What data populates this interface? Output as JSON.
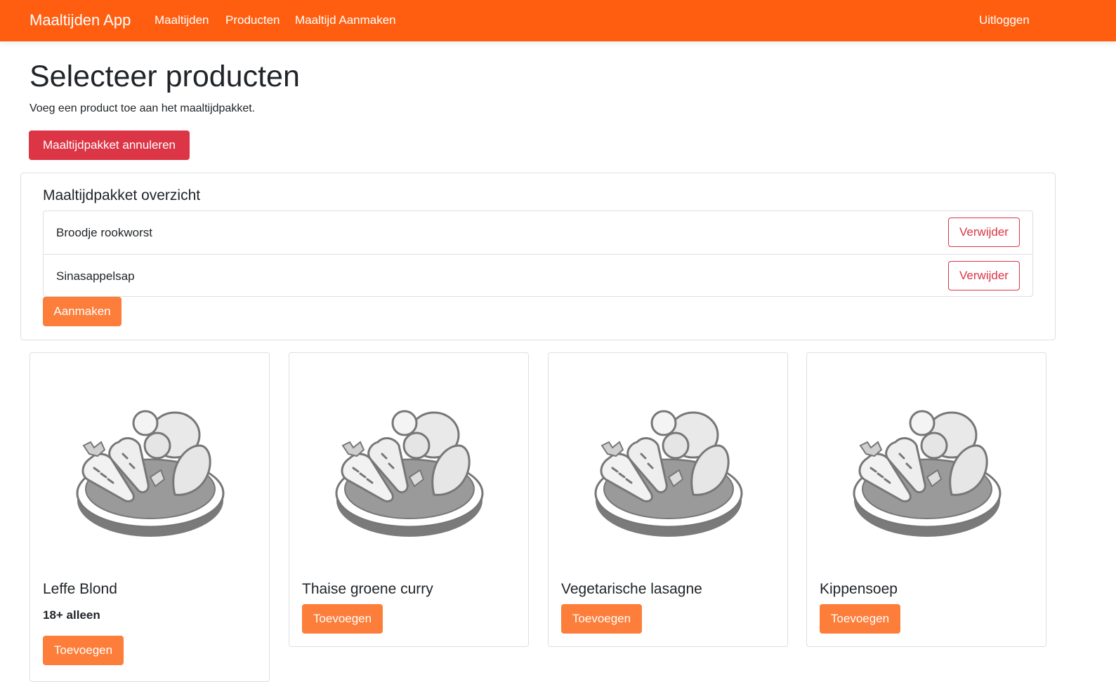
{
  "navbar": {
    "brand": "Maaltijden App",
    "links": [
      "Maaltijden",
      "Producten",
      "Maaltijd Aanmaken"
    ],
    "logout": "Uitloggen",
    "color": "#ff5e10"
  },
  "page": {
    "title": "Selecteer producten",
    "subtitle": "Voeg een product toe aan het maaltijdpakket.",
    "cancel_button": "Maaltijdpakket annuleren"
  },
  "summary": {
    "title": "Maaltijdpakket overzicht",
    "items": [
      {
        "name": "Broodje rookworst",
        "remove_label": "Verwijder"
      },
      {
        "name": "Sinasappelsap",
        "remove_label": "Verwijder"
      }
    ],
    "create_button": "Aanmaken"
  },
  "products": [
    {
      "name": "Leffe Blond",
      "note": "18+ alleen",
      "add_label": "Toevoegen",
      "image_icon": "food-bowl-icon"
    },
    {
      "name": "Thaise groene curry",
      "note": "",
      "add_label": "Toevoegen",
      "image_icon": "food-bowl-icon"
    },
    {
      "name": "Vegetarische lasagne",
      "note": "",
      "add_label": "Toevoegen",
      "image_icon": "food-bowl-icon"
    },
    {
      "name": "Kippensoep",
      "note": "",
      "add_label": "Toevoegen",
      "image_icon": "food-bowl-icon"
    }
  ],
  "colors": {
    "accent": "#fd7e3a",
    "danger": "#dc3545"
  }
}
